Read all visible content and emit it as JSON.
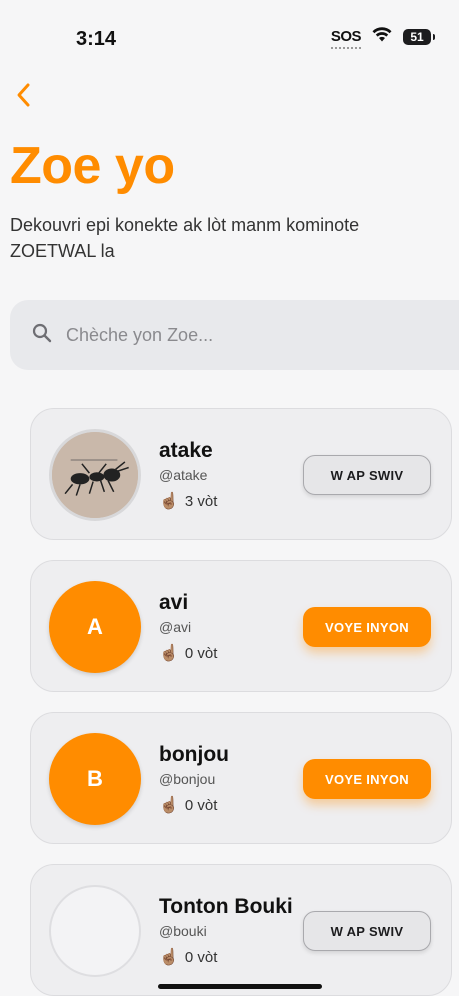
{
  "status_bar": {
    "time": "3:14",
    "sos": "SOS",
    "battery": "51"
  },
  "header": {
    "title": "Zoe yo",
    "subtitle": "Dekouvri epi konekte ak lòt manm kominote ZOETWAL la"
  },
  "search": {
    "placeholder": "Chèche yon Zoe...",
    "value": ""
  },
  "colors": {
    "accent": "#ff8c00",
    "background": "#f6f6f7",
    "card": "#eeeef0"
  },
  "users": [
    {
      "name": "atake",
      "handle": "@atake",
      "votes": "3 vòt",
      "avatar_type": "photo",
      "avatar_letter": "",
      "button_label": "W AP SWIV",
      "button_state": "following"
    },
    {
      "name": "avi",
      "handle": "@avi",
      "votes": "0 vòt",
      "avatar_type": "letter",
      "avatar_letter": "A",
      "button_label": "VOYE INYON",
      "button_state": "follow"
    },
    {
      "name": "bonjou",
      "handle": "@bonjou",
      "votes": "0 vòt",
      "avatar_type": "letter",
      "avatar_letter": "B",
      "button_label": "VOYE INYON",
      "button_state": "follow"
    },
    {
      "name": "Tonton Bouki",
      "handle": "@bouki",
      "votes": "0 vòt",
      "avatar_type": "empty",
      "avatar_letter": "",
      "button_label": "W AP SWIV",
      "button_state": "following"
    }
  ]
}
